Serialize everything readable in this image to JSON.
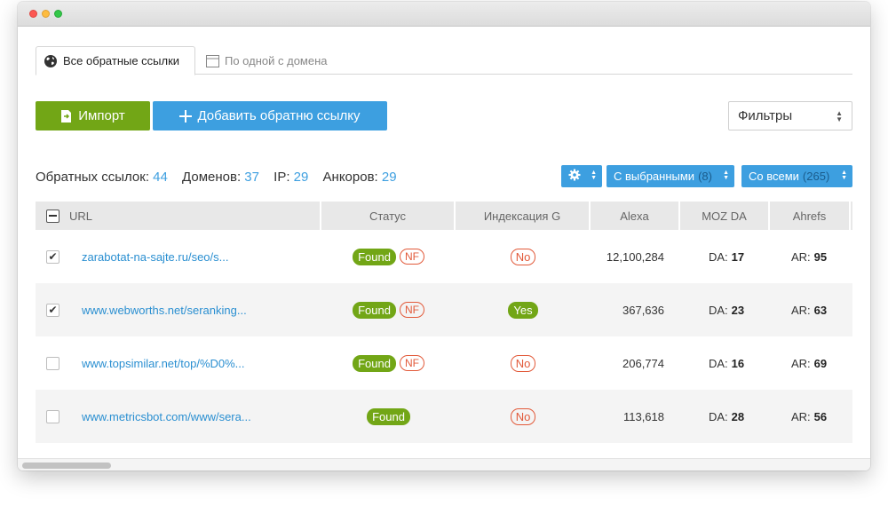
{
  "tabs": [
    {
      "label": "Все обратные ссылки",
      "icon": "globe-icon"
    },
    {
      "label": "По одной с домена",
      "icon": "window-icon"
    }
  ],
  "buttons": {
    "import_label": "Импорт",
    "add_label": "Добавить обратню ссылку",
    "filter_label": "Фильтры"
  },
  "stats": {
    "backlinks_label": "Обратных ссылок:",
    "backlinks_value": "44",
    "domains_label": "Доменов:",
    "domains_value": "37",
    "ip_label": "IP:",
    "ip_value": "29",
    "anchors_label": "Анкоров:",
    "anchors_value": "29"
  },
  "actions": {
    "selected_label": "С выбранными",
    "selected_count": "(8)",
    "all_label": "Со всеми",
    "all_count": "(265)"
  },
  "columns": [
    "URL",
    "Статус",
    "Индексация G",
    "Alexa",
    "MOZ DA",
    "Ahrefs"
  ],
  "rows": [
    {
      "checked": true,
      "url": "zarabotat-na-sajte.ru/seo/s...",
      "found": "Found",
      "nf": "NF",
      "index": "No",
      "alexa": "12,100,284",
      "da_label": "DA:",
      "da": "17",
      "ar_label": "AR:",
      "ar": "95"
    },
    {
      "checked": true,
      "url": "www.webworths.net/seranking...",
      "found": "Found",
      "nf": "NF",
      "index": "Yes",
      "alexa": "367,636",
      "da_label": "DA:",
      "da": "23",
      "ar_label": "AR:",
      "ar": "63"
    },
    {
      "checked": false,
      "url": "www.topsimilar.net/top/%D0%...",
      "found": "Found",
      "nf": "NF",
      "index": "No",
      "alexa": "206,774",
      "da_label": "DA:",
      "da": "16",
      "ar_label": "AR:",
      "ar": "69"
    },
    {
      "checked": false,
      "url": "www.metricsbot.com/www/sera...",
      "found": "Found",
      "nf": "",
      "index": "No",
      "alexa": "113,618",
      "da_label": "DA:",
      "da": "28",
      "ar_label": "AR:",
      "ar": "56"
    }
  ],
  "colors": {
    "green": "#72a616",
    "blue": "#3d9fe0",
    "red": "#e25a3a"
  }
}
